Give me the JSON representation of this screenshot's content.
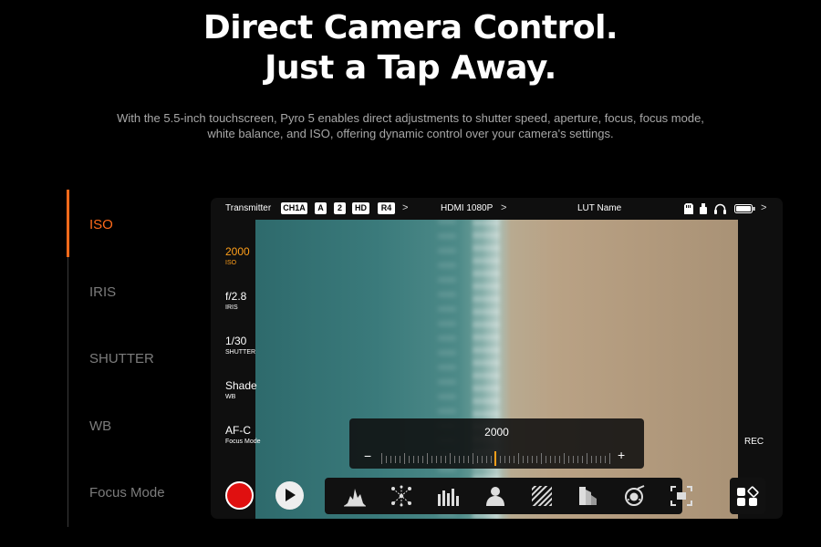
{
  "headline": {
    "line1": "Direct Camera Control.",
    "line2": "Just a Tap Away."
  },
  "description": {
    "line1": "With the 5.5-inch touchscreen, Pyro 5 enables direct adjustments to shutter speed, aperture, focus, focus mode,",
    "line2": "white balance, and ISO, offering dynamic control over your camera's settings."
  },
  "menu": {
    "items": [
      {
        "label": "ISO",
        "active": true
      },
      {
        "label": "IRIS",
        "active": false
      },
      {
        "label": "SHUTTER",
        "active": false
      },
      {
        "label": "WB",
        "active": false
      },
      {
        "label": "Focus Mode",
        "active": false
      }
    ]
  },
  "device": {
    "topbar": {
      "transmitter": "Transmitter",
      "badges": [
        "CH1A",
        "A",
        "2",
        "HD",
        "R4"
      ],
      "chevron": ">",
      "hdmi": "HDMI 1080P",
      "lut": "LUT Name"
    },
    "params": [
      {
        "value": "2000",
        "label": "ISO",
        "active": true
      },
      {
        "value": "f/2.8",
        "label": "IRIS",
        "active": false
      },
      {
        "value": "1/30",
        "label": "SHUTTER",
        "active": false
      },
      {
        "value": "Shade",
        "label": "WB",
        "active": false
      },
      {
        "value": "AF-C",
        "label": "Focus Mode",
        "active": false
      }
    ],
    "rec_label": "REC",
    "slider": {
      "value": "2000",
      "minus": "−",
      "plus": "+"
    },
    "tools": [
      "histogram-icon",
      "vectorscope-icon",
      "waveform-icon",
      "focus-peaking-icon",
      "zebra-icon",
      "false-color-icon",
      "gimbal-icon",
      "zoom-icon"
    ],
    "accent_color": "#ff6a1a",
    "param_active_color": "#ff9f1a",
    "rec_color": "#e01010"
  }
}
